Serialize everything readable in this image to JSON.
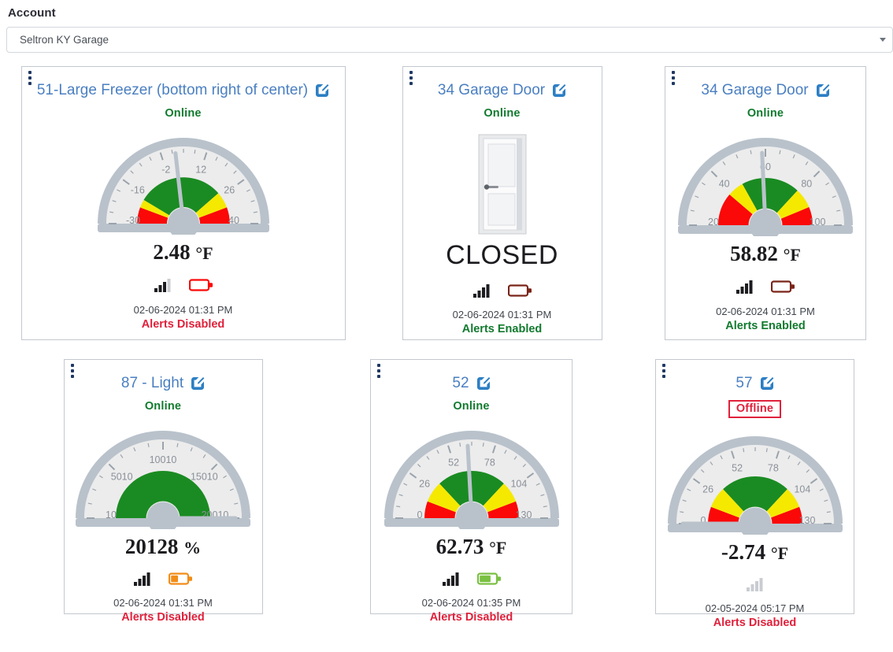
{
  "account": {
    "label": "Account",
    "selected": "Seltron KY Garage",
    "caret_icon": "chevron-down-icon"
  },
  "cards": [
    {
      "id": "card-51-large-freezer",
      "title": "51-Large Freezer (bottom right of center)",
      "edit_icon": "edit-pencil-icon",
      "kebab_icon": "kebab-menu-icon",
      "status": "Online",
      "status_state": "online",
      "display_type": "gauge",
      "reading_value": "2.48",
      "reading_unit": "°F",
      "signal_icon": "signal-bars-icon",
      "signal_bars_filled": 3,
      "signal_bars_total": 4,
      "signal_state": "active",
      "battery_icon": "battery-icon",
      "battery_level": 0,
      "battery_color": "#fb0808",
      "timestamp": "02-06-2024 01:31 PM",
      "alerts": "Alerts Disabled",
      "alerts_state": "disabled",
      "gauge": {
        "min": -30,
        "max": 40,
        "value": 2.48,
        "ticks": [
          -30,
          -16,
          -2,
          12,
          26,
          40
        ],
        "bands": [
          {
            "from": -30,
            "to": -22,
            "color": "#fb0808"
          },
          {
            "from": -22,
            "to": -18,
            "color": "#f5e900"
          },
          {
            "from": -18,
            "to": 24,
            "color": "#1a8b22"
          },
          {
            "from": 24,
            "to": 32,
            "color": "#f5e900"
          },
          {
            "from": 32,
            "to": 40,
            "color": "#fb0808"
          }
        ]
      }
    },
    {
      "id": "card-34-garage-door-a",
      "title": "34 Garage Door",
      "edit_icon": "edit-pencil-icon",
      "kebab_icon": "kebab-menu-icon",
      "status": "Online",
      "status_state": "online",
      "display_type": "door",
      "reading_value": "CLOSED",
      "reading_unit": "",
      "signal_icon": "signal-bars-icon",
      "signal_bars_filled": 4,
      "signal_bars_total": 4,
      "signal_state": "active",
      "battery_icon": "battery-icon",
      "battery_level": 0,
      "battery_color": "#7a2418",
      "timestamp": "02-06-2024 01:31 PM",
      "alerts": "Alerts Enabled",
      "alerts_state": "enabled",
      "door_icon": "door-closed-icon"
    },
    {
      "id": "card-34-garage-door-b",
      "title": "34 Garage Door",
      "edit_icon": "edit-pencil-icon",
      "kebab_icon": "kebab-menu-icon",
      "status": "Online",
      "status_state": "online",
      "display_type": "gauge",
      "reading_value": "58.82",
      "reading_unit": "°F",
      "signal_icon": "signal-bars-icon",
      "signal_bars_filled": 4,
      "signal_bars_total": 4,
      "signal_state": "active",
      "battery_icon": "battery-icon",
      "battery_level": 0,
      "battery_color": "#7a2418",
      "timestamp": "02-06-2024 01:31 PM",
      "alerts": "Alerts Enabled",
      "alerts_state": "enabled",
      "gauge": {
        "min": 20,
        "max": 100,
        "value": 58.82,
        "ticks": [
          20,
          40,
          60,
          80,
          100
        ],
        "bands": [
          {
            "from": 20,
            "to": 38,
            "color": "#fb0808"
          },
          {
            "from": 38,
            "to": 47,
            "color": "#f5e900"
          },
          {
            "from": 47,
            "to": 79,
            "color": "#1a8b22"
          },
          {
            "from": 79,
            "to": 90,
            "color": "#f5e900"
          },
          {
            "from": 90,
            "to": 100,
            "color": "#fb0808"
          }
        ]
      }
    },
    {
      "id": "card-87-light",
      "title": "87 - Light",
      "edit_icon": "edit-pencil-icon",
      "kebab_icon": "kebab-menu-icon",
      "status": "Online",
      "status_state": "online",
      "display_type": "gauge",
      "reading_value": "20128",
      "reading_unit": "%",
      "signal_icon": "signal-bars-icon",
      "signal_bars_filled": 4,
      "signal_bars_total": 4,
      "signal_state": "active",
      "battery_icon": "battery-icon",
      "battery_level": 45,
      "battery_color": "#f28c18",
      "timestamp": "02-06-2024 01:31 PM",
      "alerts": "Alerts Disabled",
      "alerts_state": "disabled",
      "gauge": {
        "min": 10,
        "max": 20010,
        "value": 20128,
        "ticks": [
          10,
          5010,
          10010,
          15010,
          20010
        ],
        "bands": [
          {
            "from": 10,
            "to": 20010,
            "color": "#1a8b22"
          }
        ]
      }
    },
    {
      "id": "card-52",
      "title": "52",
      "edit_icon": "edit-pencil-icon",
      "kebab_icon": "kebab-menu-icon",
      "status": "Online",
      "status_state": "online",
      "display_type": "gauge",
      "reading_value": "62.73",
      "reading_unit": "°F",
      "signal_icon": "signal-bars-icon",
      "signal_bars_filled": 4,
      "signal_bars_total": 4,
      "signal_state": "active",
      "battery_icon": "battery-icon",
      "battery_level": 70,
      "battery_color": "#7ac043",
      "timestamp": "02-06-2024 01:35 PM",
      "alerts": "Alerts Disabled",
      "alerts_state": "disabled",
      "gauge": {
        "min": 0,
        "max": 130,
        "value": 62.73,
        "ticks": [
          0,
          26,
          52,
          78,
          104,
          130
        ],
        "bands": [
          {
            "from": 0,
            "to": 15,
            "color": "#fb0808"
          },
          {
            "from": 15,
            "to": 34,
            "color": "#f5e900"
          },
          {
            "from": 34,
            "to": 96,
            "color": "#1a8b22"
          },
          {
            "from": 96,
            "to": 115,
            "color": "#f5e900"
          },
          {
            "from": 115,
            "to": 130,
            "color": "#fb0808"
          }
        ]
      }
    },
    {
      "id": "card-57",
      "title": "57",
      "edit_icon": "edit-pencil-icon",
      "kebab_icon": "kebab-menu-icon",
      "status": "Offline",
      "status_state": "offline",
      "display_type": "gauge",
      "reading_value": "-2.74",
      "reading_unit": "°F",
      "signal_icon": "signal-bars-icon",
      "signal_bars_filled": 0,
      "signal_bars_total": 4,
      "signal_state": "inactive",
      "battery_icon": null,
      "battery_level": null,
      "battery_color": null,
      "timestamp": "02-05-2024 05:17 PM",
      "alerts": "Alerts Disabled",
      "alerts_state": "disabled",
      "gauge": {
        "min": 0,
        "max": 130,
        "value": -2.74,
        "ticks": [
          0,
          26,
          52,
          78,
          104,
          130
        ],
        "bands": [
          {
            "from": 0,
            "to": 15,
            "color": "#fb0808"
          },
          {
            "from": 15,
            "to": 34,
            "color": "#f5e900"
          },
          {
            "from": 34,
            "to": 96,
            "color": "#1a8b22"
          },
          {
            "from": 96,
            "to": 115,
            "color": "#f5e900"
          },
          {
            "from": 115,
            "to": 130,
            "color": "#fb0808"
          }
        ]
      }
    }
  ],
  "colors": {
    "link": "#4a7fc1",
    "online": "#117a2e",
    "offline": "#e0213c",
    "gauge_rim": "#b9c2cb",
    "gauge_face": "#ececec"
  }
}
